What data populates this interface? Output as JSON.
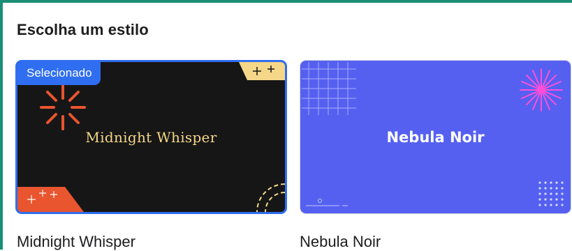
{
  "section": {
    "title": "Escolha um estilo"
  },
  "styles": [
    {
      "name": "Midnight Whisper",
      "preview_title": "Midnight Whisper",
      "selected": true,
      "badge": "Selecionado",
      "background": "#161616",
      "accent": "#e8552f",
      "text_color": "#f4d788"
    },
    {
      "name": "Nebula Noir",
      "preview_title": "Nebula Noir",
      "selected": false,
      "background": "#5560f1",
      "accent": "#ff4fd8",
      "text_color": "#ffffff"
    }
  ],
  "colors": {
    "selection_border": "#2f6ef0",
    "frame_border": "#1a8f77"
  }
}
